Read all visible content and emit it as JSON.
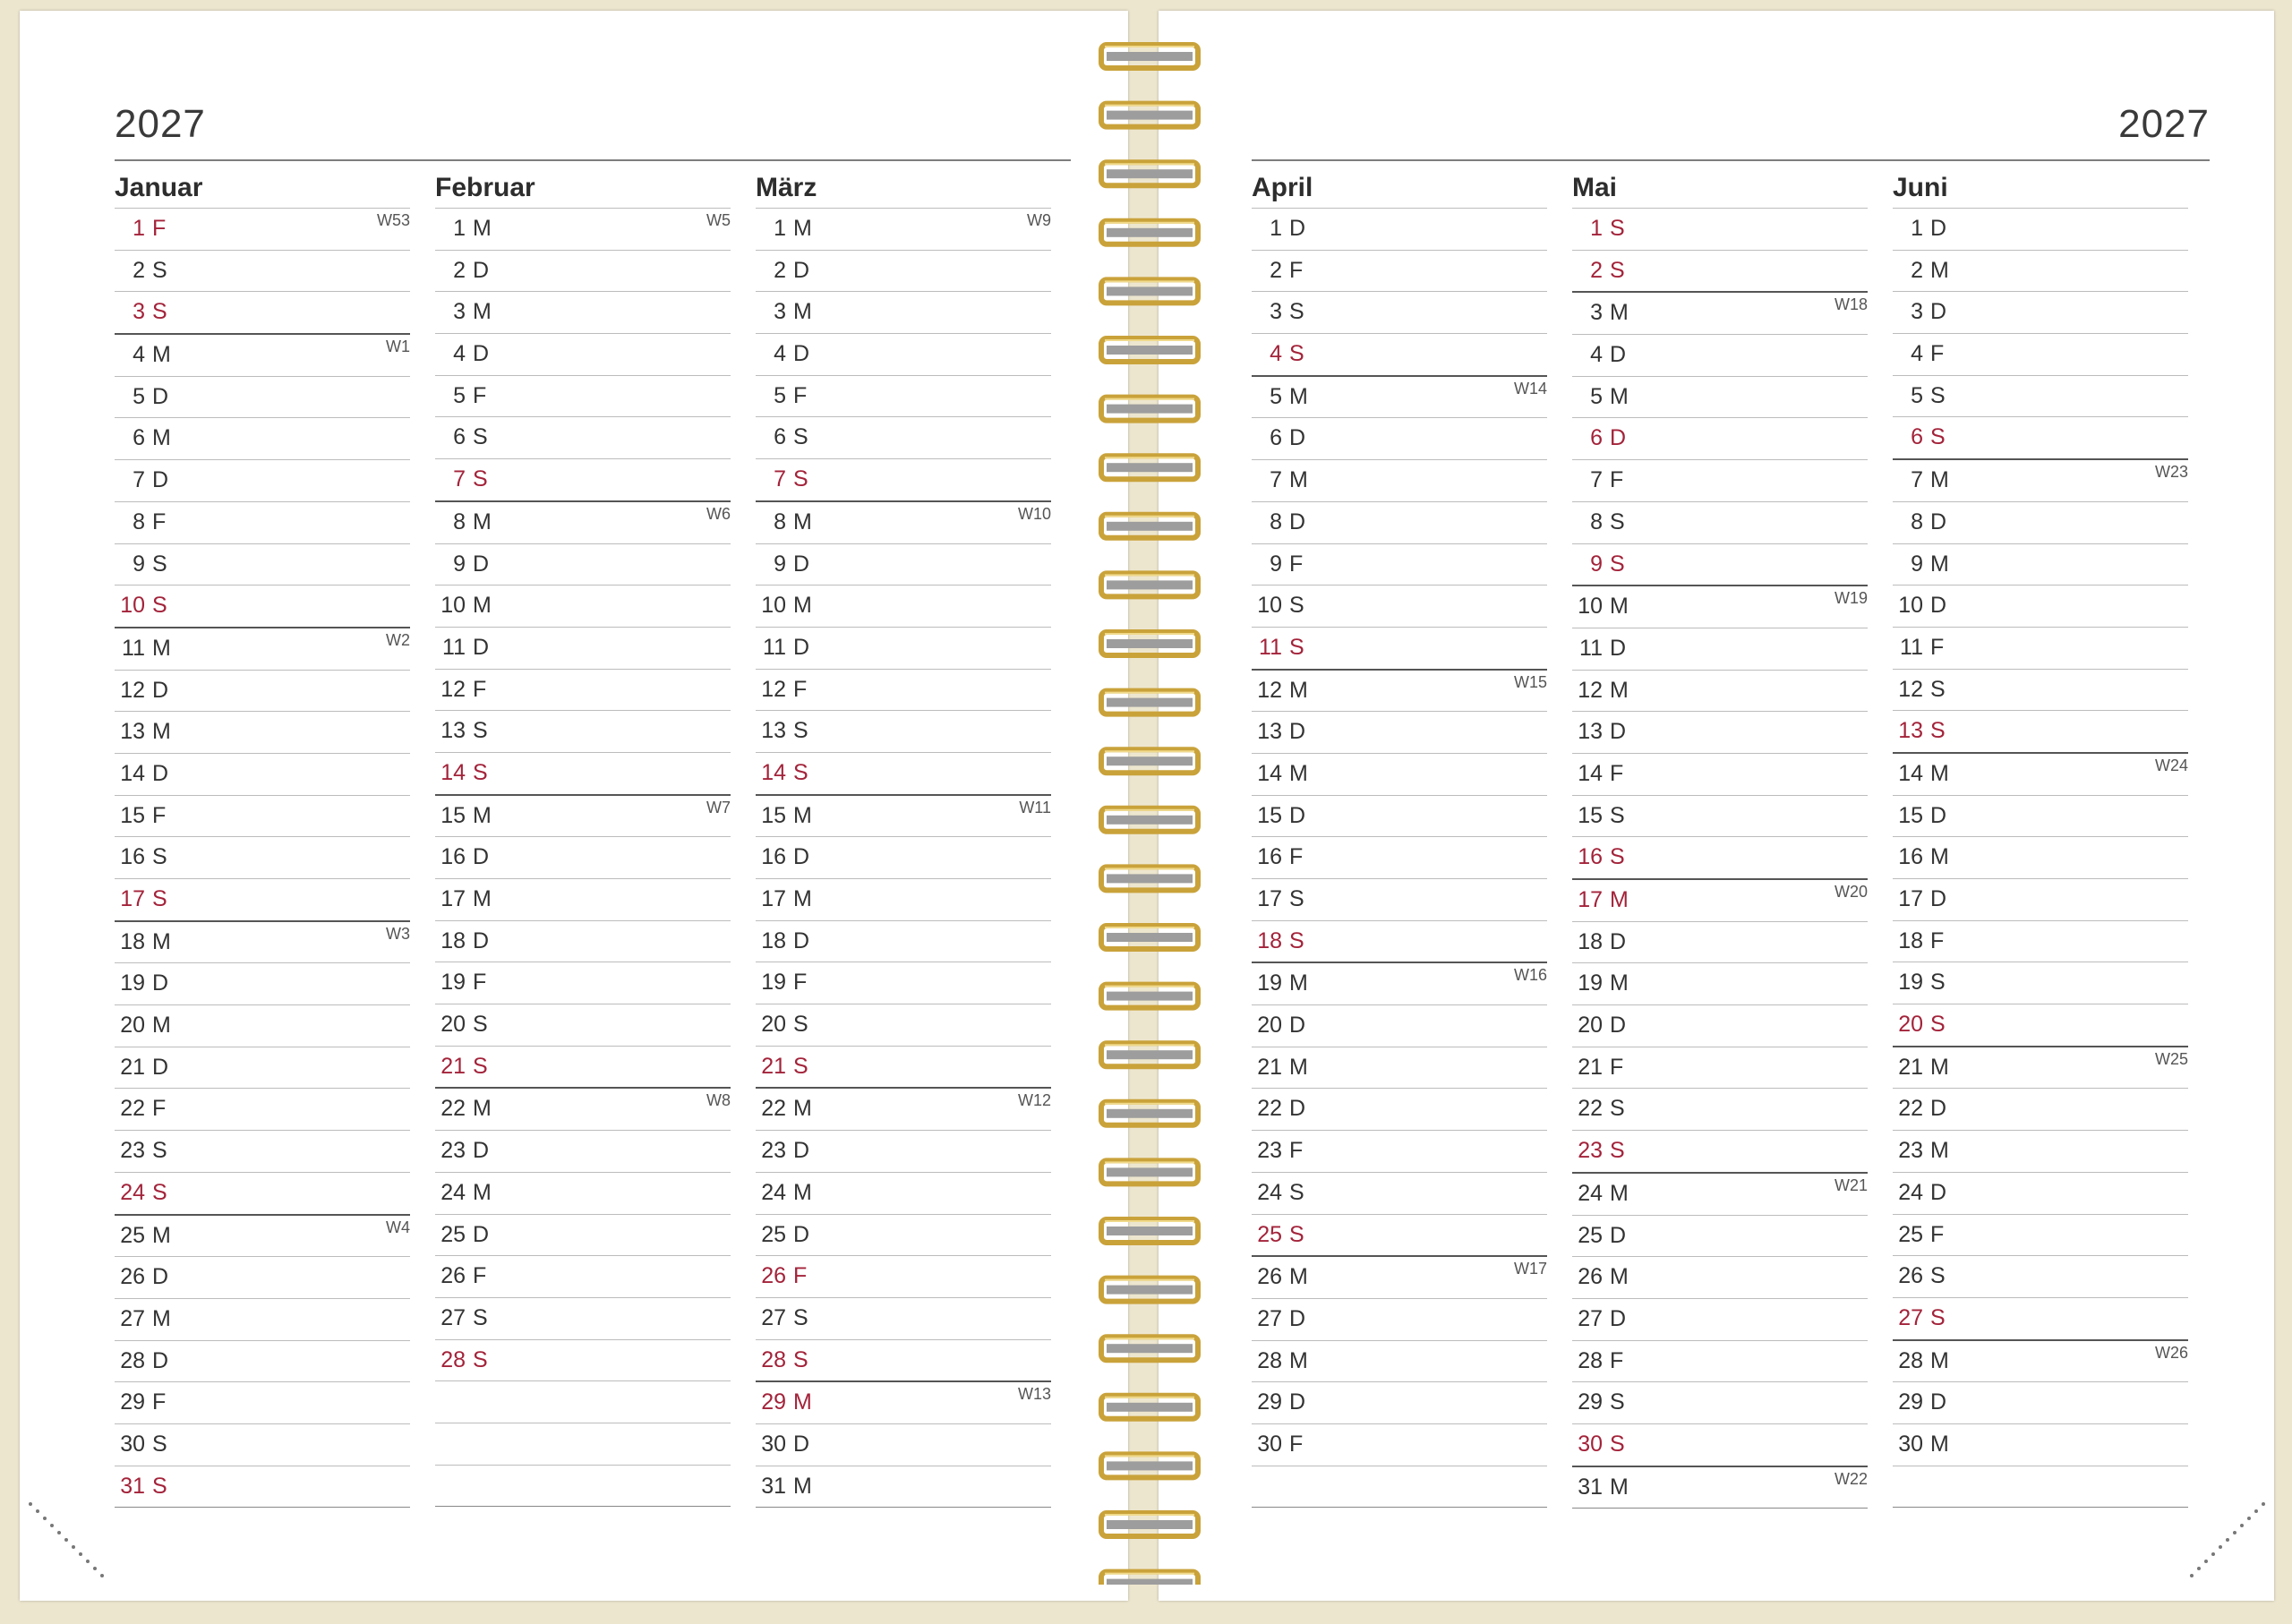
{
  "left_page": {
    "year": "2027"
  },
  "right_page": {
    "year": "2027"
  },
  "months": [
    {
      "name": "Januar",
      "days": [
        {
          "num": "1",
          "wd": "F",
          "red": true,
          "week": "W53"
        },
        {
          "num": "2",
          "wd": "S"
        },
        {
          "num": "3",
          "wd": "S",
          "red": true
        },
        {
          "num": "4",
          "wd": "M",
          "week": "W1"
        },
        {
          "num": "5",
          "wd": "D"
        },
        {
          "num": "6",
          "wd": "M"
        },
        {
          "num": "7",
          "wd": "D"
        },
        {
          "num": "8",
          "wd": "F"
        },
        {
          "num": "9",
          "wd": "S"
        },
        {
          "num": "10",
          "wd": "S",
          "red": true
        },
        {
          "num": "11",
          "wd": "M",
          "week": "W2"
        },
        {
          "num": "12",
          "wd": "D"
        },
        {
          "num": "13",
          "wd": "M"
        },
        {
          "num": "14",
          "wd": "D"
        },
        {
          "num": "15",
          "wd": "F"
        },
        {
          "num": "16",
          "wd": "S"
        },
        {
          "num": "17",
          "wd": "S",
          "red": true
        },
        {
          "num": "18",
          "wd": "M",
          "week": "W3"
        },
        {
          "num": "19",
          "wd": "D"
        },
        {
          "num": "20",
          "wd": "M"
        },
        {
          "num": "21",
          "wd": "D"
        },
        {
          "num": "22",
          "wd": "F"
        },
        {
          "num": "23",
          "wd": "S"
        },
        {
          "num": "24",
          "wd": "S",
          "red": true
        },
        {
          "num": "25",
          "wd": "M",
          "week": "W4"
        },
        {
          "num": "26",
          "wd": "D"
        },
        {
          "num": "27",
          "wd": "M"
        },
        {
          "num": "28",
          "wd": "D"
        },
        {
          "num": "29",
          "wd": "F"
        },
        {
          "num": "30",
          "wd": "S"
        },
        {
          "num": "31",
          "wd": "S",
          "red": true
        }
      ]
    },
    {
      "name": "Februar",
      "days": [
        {
          "num": "1",
          "wd": "M",
          "week": "W5"
        },
        {
          "num": "2",
          "wd": "D"
        },
        {
          "num": "3",
          "wd": "M"
        },
        {
          "num": "4",
          "wd": "D"
        },
        {
          "num": "5",
          "wd": "F"
        },
        {
          "num": "6",
          "wd": "S"
        },
        {
          "num": "7",
          "wd": "S",
          "red": true
        },
        {
          "num": "8",
          "wd": "M",
          "week": "W6"
        },
        {
          "num": "9",
          "wd": "D"
        },
        {
          "num": "10",
          "wd": "M"
        },
        {
          "num": "11",
          "wd": "D"
        },
        {
          "num": "12",
          "wd": "F"
        },
        {
          "num": "13",
          "wd": "S"
        },
        {
          "num": "14",
          "wd": "S",
          "red": true
        },
        {
          "num": "15",
          "wd": "M",
          "week": "W7"
        },
        {
          "num": "16",
          "wd": "D"
        },
        {
          "num": "17",
          "wd": "M"
        },
        {
          "num": "18",
          "wd": "D"
        },
        {
          "num": "19",
          "wd": "F"
        },
        {
          "num": "20",
          "wd": "S"
        },
        {
          "num": "21",
          "wd": "S",
          "red": true
        },
        {
          "num": "22",
          "wd": "M",
          "week": "W8"
        },
        {
          "num": "23",
          "wd": "D"
        },
        {
          "num": "24",
          "wd": "M"
        },
        {
          "num": "25",
          "wd": "D"
        },
        {
          "num": "26",
          "wd": "F"
        },
        {
          "num": "27",
          "wd": "S"
        },
        {
          "num": "28",
          "wd": "S",
          "red": true
        },
        {
          "num": "",
          "wd": ""
        },
        {
          "num": "",
          "wd": ""
        },
        {
          "num": "",
          "wd": ""
        }
      ]
    },
    {
      "name": "März",
      "days": [
        {
          "num": "1",
          "wd": "M",
          "week": "W9"
        },
        {
          "num": "2",
          "wd": "D"
        },
        {
          "num": "3",
          "wd": "M"
        },
        {
          "num": "4",
          "wd": "D"
        },
        {
          "num": "5",
          "wd": "F"
        },
        {
          "num": "6",
          "wd": "S"
        },
        {
          "num": "7",
          "wd": "S",
          "red": true
        },
        {
          "num": "8",
          "wd": "M",
          "week": "W10"
        },
        {
          "num": "9",
          "wd": "D"
        },
        {
          "num": "10",
          "wd": "M"
        },
        {
          "num": "11",
          "wd": "D"
        },
        {
          "num": "12",
          "wd": "F"
        },
        {
          "num": "13",
          "wd": "S"
        },
        {
          "num": "14",
          "wd": "S",
          "red": true
        },
        {
          "num": "15",
          "wd": "M",
          "week": "W11"
        },
        {
          "num": "16",
          "wd": "D"
        },
        {
          "num": "17",
          "wd": "M"
        },
        {
          "num": "18",
          "wd": "D"
        },
        {
          "num": "19",
          "wd": "F"
        },
        {
          "num": "20",
          "wd": "S"
        },
        {
          "num": "21",
          "wd": "S",
          "red": true
        },
        {
          "num": "22",
          "wd": "M",
          "week": "W12"
        },
        {
          "num": "23",
          "wd": "D"
        },
        {
          "num": "24",
          "wd": "M"
        },
        {
          "num": "25",
          "wd": "D"
        },
        {
          "num": "26",
          "wd": "F",
          "red": true
        },
        {
          "num": "27",
          "wd": "S"
        },
        {
          "num": "28",
          "wd": "S",
          "red": true
        },
        {
          "num": "29",
          "wd": "M",
          "red": true,
          "week": "W13"
        },
        {
          "num": "30",
          "wd": "D"
        },
        {
          "num": "31",
          "wd": "M"
        }
      ]
    },
    {
      "name": "April",
      "days": [
        {
          "num": "1",
          "wd": "D"
        },
        {
          "num": "2",
          "wd": "F"
        },
        {
          "num": "3",
          "wd": "S"
        },
        {
          "num": "4",
          "wd": "S",
          "red": true
        },
        {
          "num": "5",
          "wd": "M",
          "week": "W14"
        },
        {
          "num": "6",
          "wd": "D"
        },
        {
          "num": "7",
          "wd": "M"
        },
        {
          "num": "8",
          "wd": "D"
        },
        {
          "num": "9",
          "wd": "F"
        },
        {
          "num": "10",
          "wd": "S"
        },
        {
          "num": "11",
          "wd": "S",
          "red": true
        },
        {
          "num": "12",
          "wd": "M",
          "week": "W15"
        },
        {
          "num": "13",
          "wd": "D"
        },
        {
          "num": "14",
          "wd": "M"
        },
        {
          "num": "15",
          "wd": "D"
        },
        {
          "num": "16",
          "wd": "F"
        },
        {
          "num": "17",
          "wd": "S"
        },
        {
          "num": "18",
          "wd": "S",
          "red": true
        },
        {
          "num": "19",
          "wd": "M",
          "week": "W16"
        },
        {
          "num": "20",
          "wd": "D"
        },
        {
          "num": "21",
          "wd": "M"
        },
        {
          "num": "22",
          "wd": "D"
        },
        {
          "num": "23",
          "wd": "F"
        },
        {
          "num": "24",
          "wd": "S"
        },
        {
          "num": "25",
          "wd": "S",
          "red": true
        },
        {
          "num": "26",
          "wd": "M",
          "week": "W17"
        },
        {
          "num": "27",
          "wd": "D"
        },
        {
          "num": "28",
          "wd": "M"
        },
        {
          "num": "29",
          "wd": "D"
        },
        {
          "num": "30",
          "wd": "F"
        },
        {
          "num": "",
          "wd": ""
        }
      ]
    },
    {
      "name": "Mai",
      "days": [
        {
          "num": "1",
          "wd": "S",
          "red": true
        },
        {
          "num": "2",
          "wd": "S",
          "red": true
        },
        {
          "num": "3",
          "wd": "M",
          "week": "W18"
        },
        {
          "num": "4",
          "wd": "D"
        },
        {
          "num": "5",
          "wd": "M"
        },
        {
          "num": "6",
          "wd": "D",
          "red": true
        },
        {
          "num": "7",
          "wd": "F"
        },
        {
          "num": "8",
          "wd": "S"
        },
        {
          "num": "9",
          "wd": "S",
          "red": true
        },
        {
          "num": "10",
          "wd": "M",
          "week": "W19"
        },
        {
          "num": "11",
          "wd": "D"
        },
        {
          "num": "12",
          "wd": "M"
        },
        {
          "num": "13",
          "wd": "D"
        },
        {
          "num": "14",
          "wd": "F"
        },
        {
          "num": "15",
          "wd": "S"
        },
        {
          "num": "16",
          "wd": "S",
          "red": true
        },
        {
          "num": "17",
          "wd": "M",
          "red": true,
          "week": "W20"
        },
        {
          "num": "18",
          "wd": "D"
        },
        {
          "num": "19",
          "wd": "M"
        },
        {
          "num": "20",
          "wd": "D"
        },
        {
          "num": "21",
          "wd": "F"
        },
        {
          "num": "22",
          "wd": "S"
        },
        {
          "num": "23",
          "wd": "S",
          "red": true
        },
        {
          "num": "24",
          "wd": "M",
          "week": "W21"
        },
        {
          "num": "25",
          "wd": "D"
        },
        {
          "num": "26",
          "wd": "M"
        },
        {
          "num": "27",
          "wd": "D"
        },
        {
          "num": "28",
          "wd": "F"
        },
        {
          "num": "29",
          "wd": "S"
        },
        {
          "num": "30",
          "wd": "S",
          "red": true
        },
        {
          "num": "31",
          "wd": "M",
          "week": "W22"
        }
      ]
    },
    {
      "name": "Juni",
      "days": [
        {
          "num": "1",
          "wd": "D"
        },
        {
          "num": "2",
          "wd": "M"
        },
        {
          "num": "3",
          "wd": "D"
        },
        {
          "num": "4",
          "wd": "F"
        },
        {
          "num": "5",
          "wd": "S"
        },
        {
          "num": "6",
          "wd": "S",
          "red": true
        },
        {
          "num": "7",
          "wd": "M",
          "week": "W23"
        },
        {
          "num": "8",
          "wd": "D"
        },
        {
          "num": "9",
          "wd": "M"
        },
        {
          "num": "10",
          "wd": "D"
        },
        {
          "num": "11",
          "wd": "F"
        },
        {
          "num": "12",
          "wd": "S"
        },
        {
          "num": "13",
          "wd": "S",
          "red": true
        },
        {
          "num": "14",
          "wd": "M",
          "week": "W24"
        },
        {
          "num": "15",
          "wd": "D"
        },
        {
          "num": "16",
          "wd": "M"
        },
        {
          "num": "17",
          "wd": "D"
        },
        {
          "num": "18",
          "wd": "F"
        },
        {
          "num": "19",
          "wd": "S"
        },
        {
          "num": "20",
          "wd": "S",
          "red": true
        },
        {
          "num": "21",
          "wd": "M",
          "week": "W25"
        },
        {
          "num": "22",
          "wd": "D"
        },
        {
          "num": "23",
          "wd": "M"
        },
        {
          "num": "24",
          "wd": "D"
        },
        {
          "num": "25",
          "wd": "F"
        },
        {
          "num": "26",
          "wd": "S"
        },
        {
          "num": "27",
          "wd": "S",
          "red": true
        },
        {
          "num": "28",
          "wd": "M",
          "week": "W26"
        },
        {
          "num": "29",
          "wd": "D"
        },
        {
          "num": "30",
          "wd": "M"
        },
        {
          "num": "",
          "wd": ""
        }
      ]
    }
  ],
  "colors": {
    "holiday": "#a3233a",
    "text": "#333333",
    "spiral": "#c9a23a"
  }
}
